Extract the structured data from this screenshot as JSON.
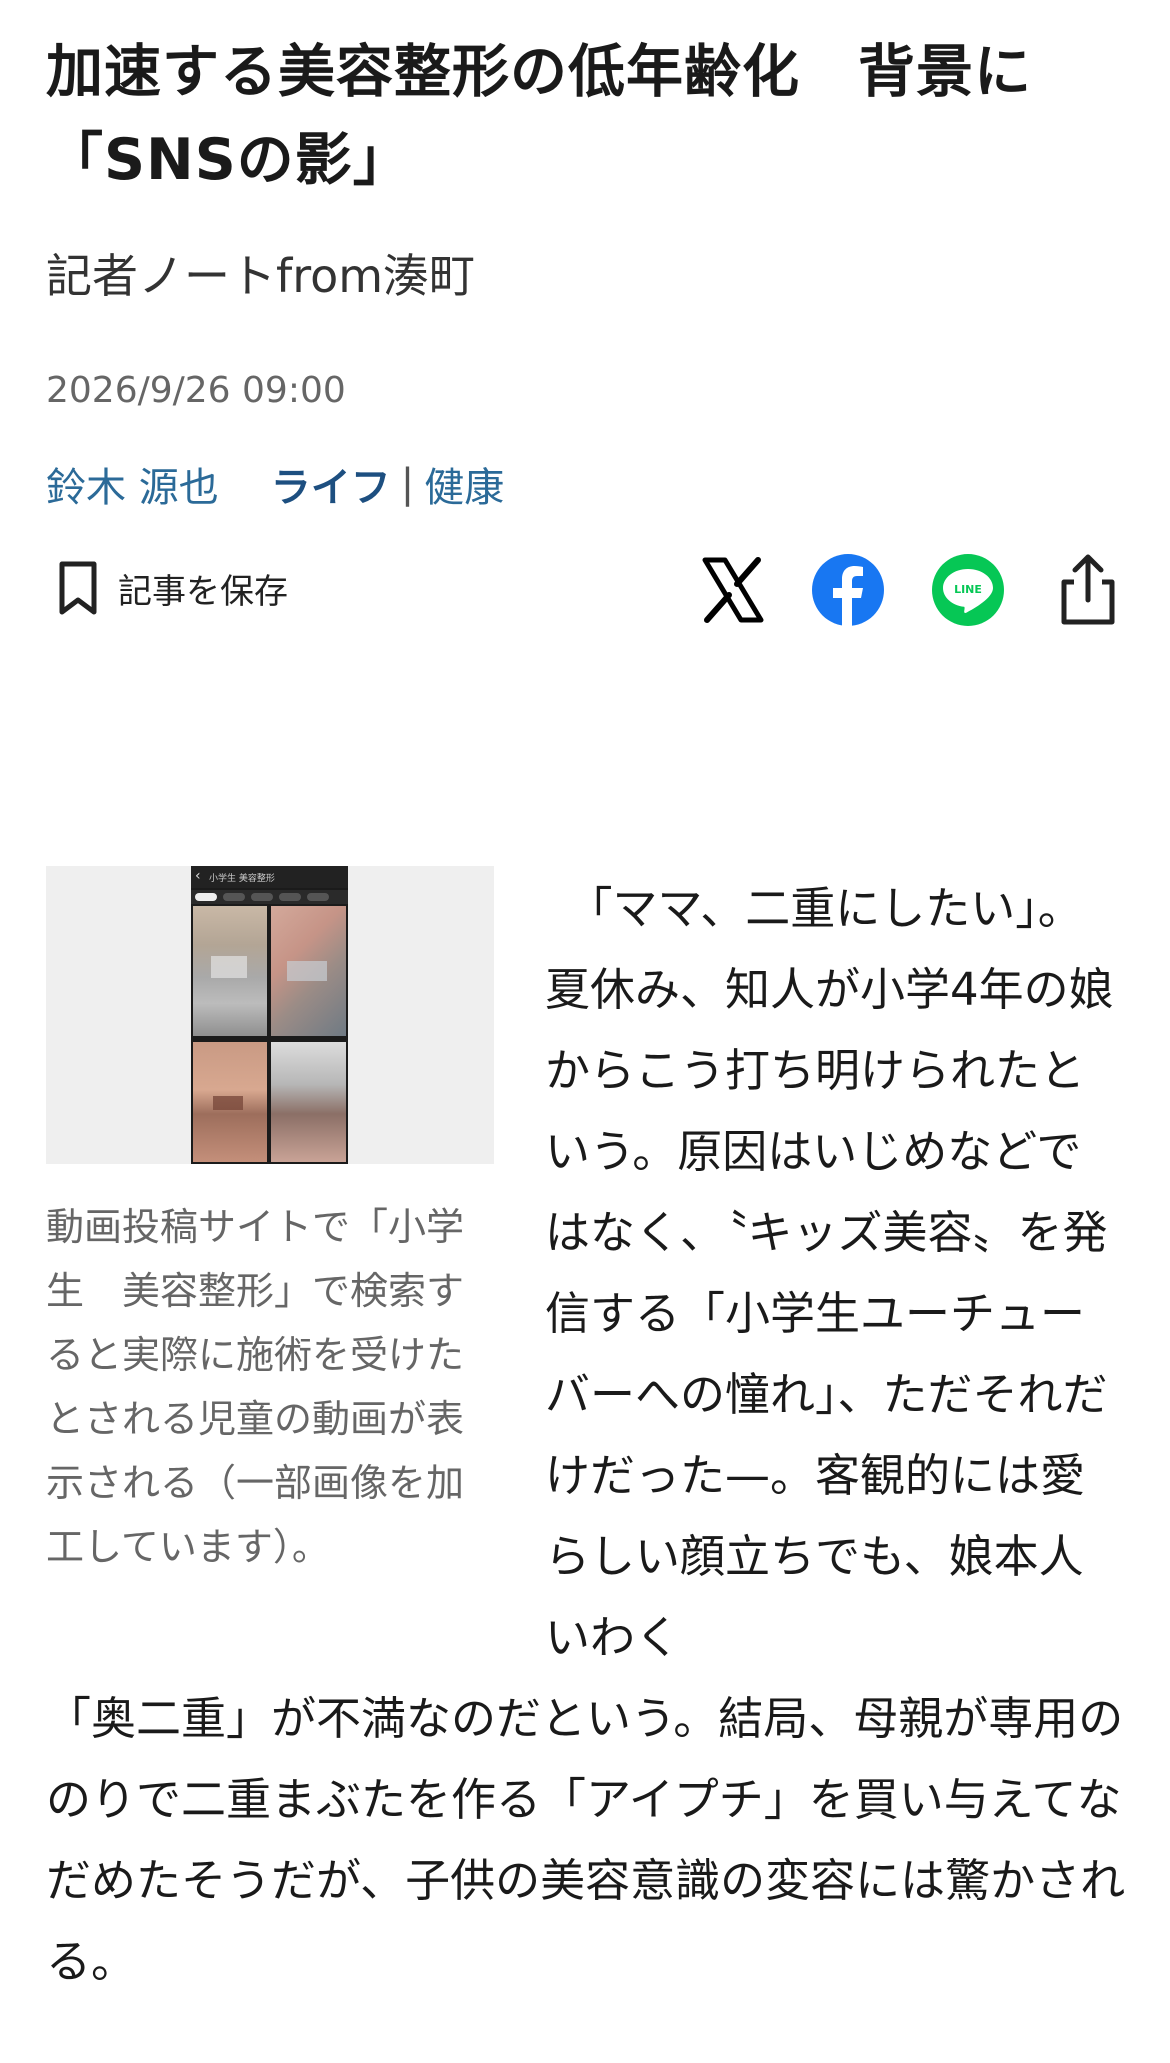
{
  "article": {
    "headline": "加速する美容整形の低年齢化　背景に「SNSの影」",
    "series": "記者ノートfrom湊町",
    "date": "2026/9/26 09:00",
    "author": "鈴木 源也",
    "category": "ライフ",
    "separator": "|",
    "subcategory": "健康",
    "save_label": "記事を保存",
    "colors": {
      "link": "#2b6a98",
      "category": "#1d4f80",
      "facebook": "#1877f2",
      "line": "#06c755"
    },
    "share_icons": [
      "x-icon",
      "facebook-icon",
      "line-icon",
      "share-icon"
    ],
    "figure": {
      "screen_bar_text": "小学生 美容整形",
      "caption": "動画投稿サイトで「小学生　美容整形」で検索すると実際に施術を受けたとされる児童の動画が表示される（一部画像を加工しています）。"
    },
    "body_column": "　「ママ、二重にしたい」。夏休み、知人が小学4年の娘からこう打ち明けられたという。原因はいじめなどではなく、〝キッズ美容〟を発信する「小学生ユーチューバーへの憧れ」、ただそれだけだった—。客観的には愛らしい顔立ちでも、娘本人いわく",
    "body_full": "「奥二重」が不満なのだという。結局、母親が専用ののりで二重まぶたを作る「アイプチ」を買い与えてなだめたそうだが、子供の美容意識の変容には驚かされる。"
  }
}
